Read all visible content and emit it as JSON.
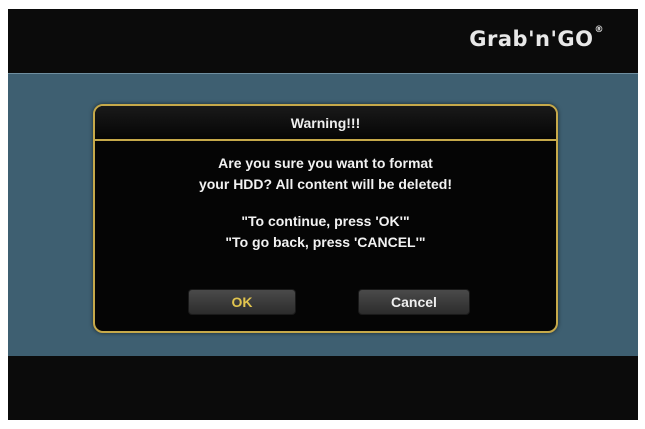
{
  "brand": {
    "name": "Grab'n'GO",
    "mark": "®"
  },
  "dialog": {
    "title": "Warning!!!",
    "message_lines": [
      "Are you sure you want to format",
      "your HDD? All content will be deleted!"
    ],
    "instruction_lines": [
      "\"To continue, press 'OK'\"",
      "\"To go back, press 'CANCEL'\""
    ],
    "ok_label": "OK",
    "cancel_label": "Cancel"
  },
  "colors": {
    "accent_gold": "#c6a94a",
    "background_blue": "#3e5f71",
    "selected_text": "#e1c44e"
  }
}
